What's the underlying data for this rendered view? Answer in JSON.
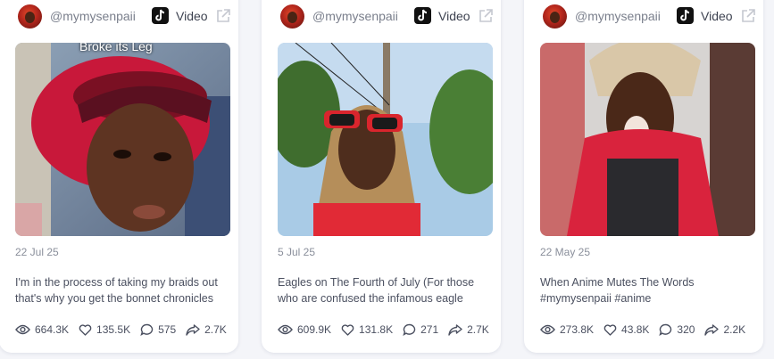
{
  "cards": [
    {
      "username": "@mymysenpaii",
      "type": "Video",
      "thumb_caption": "Broke its Leg",
      "date": "22 Jul 25",
      "caption": "I'm in the process of taking my braids out that's why you get the bonnet chronicles",
      "views": "664.3K",
      "likes": "135.5K",
      "comments": "575",
      "shares": "2.7K"
    },
    {
      "username": "@mymysenpaii",
      "type": "Video",
      "date": "5 Jul 25",
      "caption": "Eagles on The Fourth of July (For those who are confused the infamous eagle",
      "views": "609.9K",
      "likes": "131.8K",
      "comments": "271",
      "shares": "2.7K"
    },
    {
      "username": "@mymysenpaii",
      "type": "Video",
      "date": "22 May 25",
      "caption": "When Anime Mutes The Words #mymysenpaii #anime",
      "views": "273.8K",
      "likes": "43.8K",
      "comments": "320",
      "shares": "2.2K"
    }
  ],
  "icons": {
    "platform": "tiktok-icon",
    "open": "external-link-icon",
    "views": "eye-icon",
    "likes": "heart-icon",
    "comments": "comment-icon",
    "shares": "share-icon"
  },
  "colors": {
    "background": "#f4f5f9",
    "card": "#ffffff",
    "muted_text": "#8a8f9b",
    "body_text": "#4b5060"
  }
}
